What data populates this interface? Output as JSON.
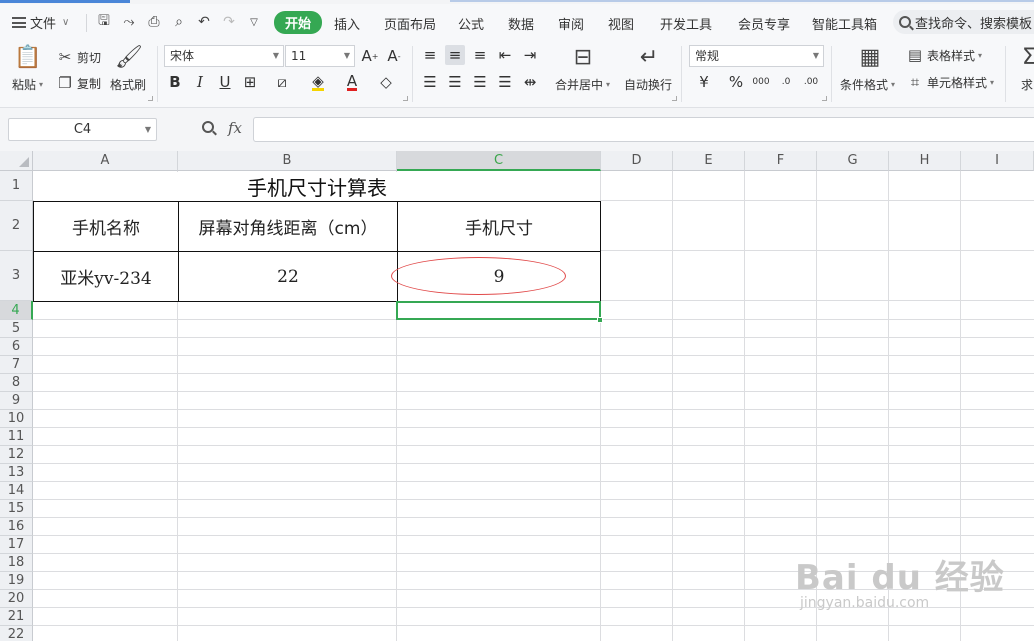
{
  "menu": {
    "file_label": "文件",
    "tabs": [
      "开始",
      "插入",
      "页面布局",
      "公式",
      "数据",
      "审阅",
      "视图",
      "开发工具",
      "会员专享",
      "智能工具箱"
    ],
    "search_placeholder": "查找命令、搜索模板"
  },
  "ribbon": {
    "paste": "粘贴",
    "cut": "剪切",
    "copy": "复制",
    "format_painter": "格式刷",
    "font_name": "宋体",
    "font_size": "11",
    "merge_center": "合并居中",
    "wrap_text": "自动换行",
    "number_format": "常规",
    "conditional_format": "条件格式",
    "table_style": "表格样式",
    "cell_style": "单元格样式",
    "sum_partial": "求"
  },
  "formula_bar": {
    "name_box": "C4",
    "fx": "fx",
    "content": ""
  },
  "grid": {
    "columns": [
      "A",
      "B",
      "C",
      "D",
      "E",
      "F",
      "G",
      "H",
      "I"
    ],
    "rows": [
      "1",
      "2",
      "3",
      "4",
      "5",
      "6",
      "7",
      "8",
      "9",
      "10",
      "11",
      "12",
      "13",
      "14",
      "15",
      "16",
      "17",
      "18",
      "19",
      "20",
      "21",
      "22"
    ],
    "active_cell": "C4"
  },
  "sheet": {
    "title": "手机尺寸计算表",
    "headers": [
      "手机名称",
      "屏幕对角线距离（cm）",
      "手机尺寸"
    ],
    "row3": [
      "亚米yv-234",
      "22",
      "9"
    ]
  },
  "watermark": {
    "text": "Bai du 经验",
    "url": "jingyan.baidu.com"
  }
}
